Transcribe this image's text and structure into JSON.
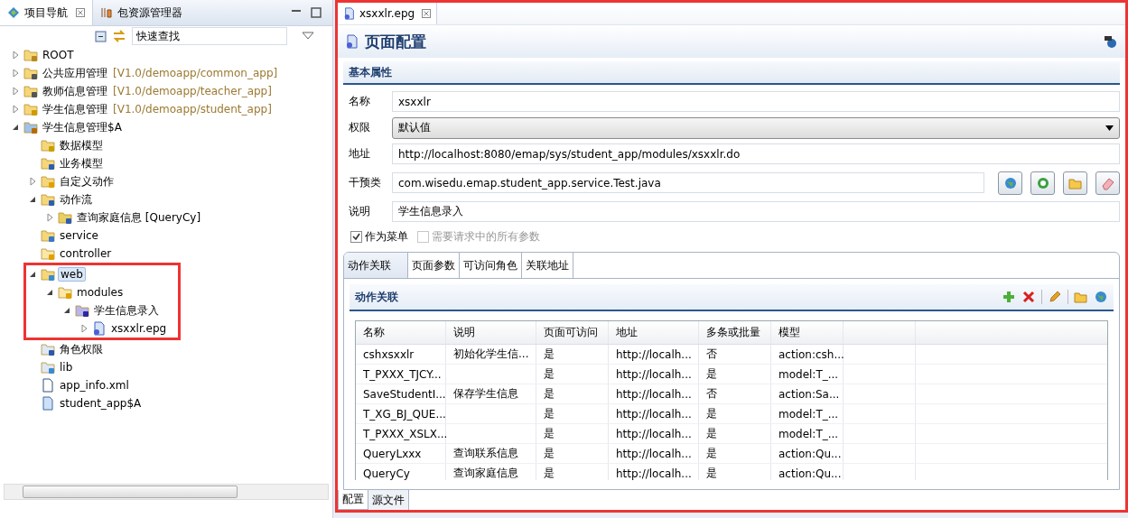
{
  "navigator": {
    "tabs": [
      {
        "label": "项目导航",
        "selected": true
      },
      {
        "label": "包资源管理器",
        "selected": false
      }
    ],
    "search": {
      "value": "快速查找"
    },
    "tree": [
      {
        "label": "ROOT",
        "kind": "folder-open",
        "expanded": false,
        "selected": false
      },
      {
        "label": "公共应用管理",
        "suffix": "[V1.0/demoapp/common_app]",
        "kind": "app",
        "expanded": false,
        "selected": false
      },
      {
        "label": "教师信息管理",
        "suffix": "[V1.0/demoapp/teacher_app]",
        "kind": "app",
        "expanded": false,
        "selected": false
      },
      {
        "label": "学生信息管理",
        "suffix": "[V1.0/demoapp/student_app]",
        "kind": "app-warning",
        "expanded": false,
        "selected": false
      },
      {
        "label": "学生信息管理$A",
        "kind": "project",
        "expanded": true,
        "selected": false,
        "children": [
          {
            "label": "数据模型",
            "kind": "db-folder",
            "selected": false
          },
          {
            "label": "业务模型",
            "kind": "biz-folder",
            "selected": false
          },
          {
            "label": "自定义动作",
            "kind": "action-folder",
            "expanded": false,
            "selected": false
          },
          {
            "label": "动作流",
            "kind": "flow-folder",
            "expanded": true,
            "selected": false,
            "children": [
              {
                "label": "查询家庭信息 [QueryCy]",
                "kind": "flow",
                "expanded": false,
                "selected": false
              }
            ]
          },
          {
            "label": "service",
            "kind": "service-folder",
            "selected": false
          },
          {
            "label": "controller",
            "kind": "new-folder",
            "selected": false
          },
          {
            "label": "web",
            "kind": "web-folder",
            "expanded": true,
            "selected": true,
            "annotated": true,
            "children": [
              {
                "label": "modules",
                "kind": "new-folder",
                "expanded": true,
                "selected": false,
                "children": [
                  {
                    "label": "学生信息录入",
                    "kind": "module-folder",
                    "expanded": true,
                    "selected": false,
                    "children": [
                      {
                        "label": "xsxxlr.epg",
                        "kind": "page",
                        "expanded": false,
                        "selected": false
                      }
                    ]
                  }
                ]
              }
            ]
          },
          {
            "label": "角色权限",
            "kind": "roles",
            "selected": false
          },
          {
            "label": "lib",
            "kind": "lib",
            "selected": false
          },
          {
            "label": "app_info.xml",
            "kind": "xml",
            "selected": false
          },
          {
            "label": "student_app$A",
            "kind": "archive",
            "selected": false
          }
        ]
      }
    ]
  },
  "editor": {
    "annotated": true,
    "tab": {
      "label": "xsxxlr.epg"
    },
    "title": "页面配置",
    "section": "基本属性",
    "fields": [
      {
        "kind": "text",
        "label": "名称",
        "value": "xsxxlr"
      },
      {
        "kind": "select",
        "label": "权限",
        "value": "默认值"
      },
      {
        "kind": "text",
        "label": "地址",
        "value": "http://localhost:8080/emap/sys/student_app/modules/xsxxlr.do"
      },
      {
        "kind": "class",
        "label": "干预类",
        "value": "com.wisedu.emap.student_app.service.Test.java"
      },
      {
        "kind": "text",
        "label": "说明",
        "value": "学生信息录入"
      }
    ],
    "checkboxes": [
      {
        "label": "作为菜单",
        "checked": true,
        "disabled": false
      },
      {
        "label": "需要请求中的所有参数",
        "checked": false,
        "disabled": true
      }
    ],
    "tabs": [
      {
        "label": "动作关联",
        "selected": true
      },
      {
        "label": "页面参数",
        "selected": false
      },
      {
        "label": "可访问角色",
        "selected": false
      },
      {
        "label": "关联地址",
        "selected": false
      }
    ],
    "table_section": "动作关联",
    "table": {
      "columns": [
        "名称",
        "说明",
        "页面可访问",
        "地址",
        "多条或批量",
        "模型"
      ],
      "rows": [
        [
          "cshxsxxlr",
          "初始化学生信...",
          "是",
          "http://localh...",
          "否",
          "action:csh..."
        ],
        [
          "T_PXXX_TJCY...",
          "",
          "是",
          "http://localh...",
          "是",
          "model:T_..."
        ],
        [
          "SaveStudentI...",
          "保存学生信息",
          "是",
          "http://localh...",
          "否",
          "action:Sa..."
        ],
        [
          "T_XG_BJ_QUE...",
          "",
          "是",
          "http://localh...",
          "是",
          "model:T_..."
        ],
        [
          "T_PXXX_XSLX...",
          "",
          "是",
          "http://localh...",
          "是",
          "model:T_..."
        ],
        [
          "QueryLxxx",
          "查询联系信息",
          "是",
          "http://localh...",
          "是",
          "action:Qu..."
        ],
        [
          "QueryCy",
          "查询家庭信息",
          "是",
          "http://localh...",
          "是",
          "action:Qu..."
        ]
      ]
    },
    "bottom_tabs": [
      {
        "label": "配置",
        "selected": true
      },
      {
        "label": "源文件",
        "selected": false
      }
    ]
  }
}
